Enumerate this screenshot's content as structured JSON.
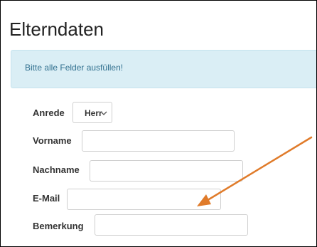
{
  "page": {
    "title": "Elterndaten",
    "info_message": "Bitte alle Felder ausfüllen!"
  },
  "form": {
    "anrede": {
      "label": "Anrede",
      "selected": "Herr"
    },
    "vorname": {
      "label": "Vorname",
      "value": ""
    },
    "nachname": {
      "label": "Nachname",
      "value": ""
    },
    "email": {
      "label": "E-Mail",
      "value": ""
    },
    "bemerkung": {
      "label": "Bemerkung",
      "value": ""
    }
  },
  "colors": {
    "info_bg": "#daeef5",
    "info_text": "#31708f",
    "annotation_arrow": "#e07b2a"
  },
  "icons": {
    "select_chevron": "chevron-down-icon",
    "annotation": "annotation-arrow"
  }
}
